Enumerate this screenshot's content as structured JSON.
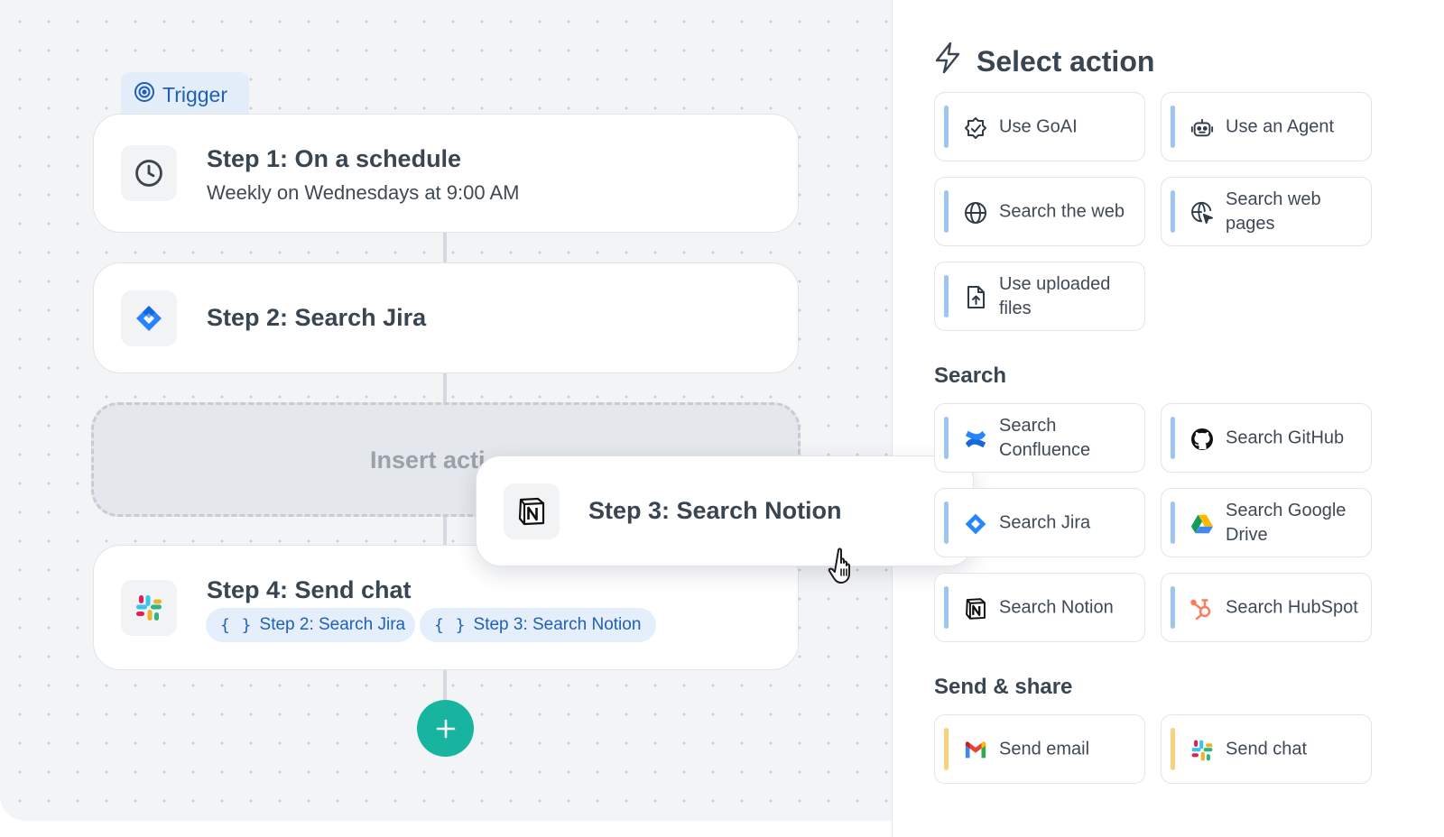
{
  "canvas": {
    "trigger_label": "Trigger",
    "step1": {
      "title": "Step 1: On a schedule",
      "subtitle": "Weekly on Wednesdays at 9:00 AM",
      "icon": "clock-icon"
    },
    "step2": {
      "title": "Step 2: Search Jira",
      "icon": "jira-icon"
    },
    "insert_placeholder": "Insert acti",
    "dragging_step": {
      "title": "Step 3: Search Notion",
      "icon": "notion-icon"
    },
    "step4": {
      "title": "Step 4: Send chat",
      "icon": "slack-icon",
      "chips": [
        {
          "brace": "{ }",
          "label": "Step 2: Search Jira"
        },
        {
          "brace": "{ }",
          "label": "Step 3: Search Notion"
        }
      ]
    },
    "add_step_symbol": "+"
  },
  "panel": {
    "title": "Select action",
    "top_actions": [
      {
        "label": "Use GoAI",
        "icon": "goai-icon"
      },
      {
        "label": "Use an Agent",
        "icon": "robot-icon"
      },
      {
        "label": "Search the web",
        "icon": "globe-icon"
      },
      {
        "label": "Search web pages",
        "icon": "web-pages-icon"
      },
      {
        "label": "Use uploaded files",
        "icon": "file-upload-icon"
      }
    ],
    "search_section": {
      "label": "Search",
      "items": [
        {
          "label": "Search Confluence",
          "icon": "confluence-icon"
        },
        {
          "label": "Search GitHub",
          "icon": "github-icon"
        },
        {
          "label": "Search Jira",
          "icon": "jira-icon"
        },
        {
          "label": "Search Google Drive",
          "icon": "google-drive-icon"
        },
        {
          "label": "Search Notion",
          "icon": "notion-icon"
        },
        {
          "label": "Search HubSpot",
          "icon": "hubspot-icon"
        }
      ]
    },
    "send_section": {
      "label": "Send & share",
      "items": [
        {
          "label": "Send email",
          "icon": "gmail-icon"
        },
        {
          "label": "Send chat",
          "icon": "slack-icon"
        }
      ]
    }
  },
  "colors": {
    "accent_blue": "#1f5fb8",
    "add_button_teal": "#17b5a0",
    "action_bar_blue": "#9ec4f0",
    "action_bar_gold": "#f6d27b"
  }
}
